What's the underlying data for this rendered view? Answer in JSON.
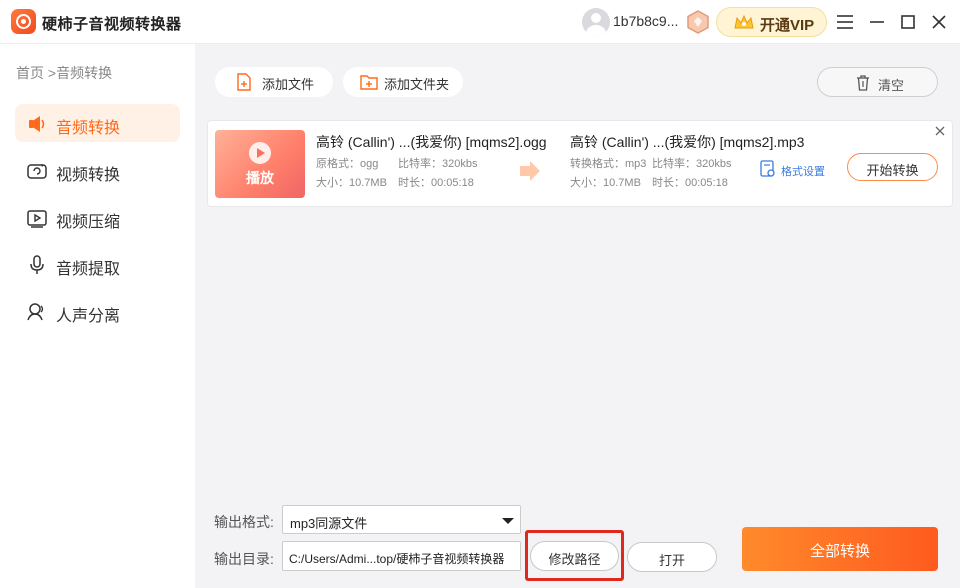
{
  "app": {
    "title": "硬柿子音视频转换器"
  },
  "header": {
    "username": "1b7b8c9...",
    "vip_label": "开通VIP"
  },
  "sidebar": {
    "breadcrumb": "首页 >音频转换",
    "items": [
      {
        "label": "音频转换",
        "icon": "audio-convert-icon",
        "active": true
      },
      {
        "label": "视频转换",
        "icon": "video-convert-icon",
        "active": false
      },
      {
        "label": "视频压缩",
        "icon": "video-compress-icon",
        "active": false
      },
      {
        "label": "音频提取",
        "icon": "audio-extract-icon",
        "active": false
      },
      {
        "label": "人声分离",
        "icon": "vocal-separate-icon",
        "active": false
      }
    ]
  },
  "toolbar": {
    "add_file": "添加文件",
    "add_folder": "添加文件夹",
    "clear": "清空"
  },
  "file": {
    "play_label": "播放",
    "source": {
      "name": "高铃 (Callin') ...(我爱你) [mqms2].ogg",
      "format": "原格式：ogg",
      "bitrate": "比特率：320kbs",
      "size": "大小：10.7MB",
      "duration": "时长：00:05:18"
    },
    "target": {
      "name": "高铃 (Callin') ...(我爱你) [mqms2].mp3",
      "format": "转换格式：mp3",
      "bitrate": "比特率：320kbs",
      "size": "大小：10.7MB",
      "duration": "时长：00:05:18"
    },
    "format_settings": "格式设置",
    "start_button": "开始转换"
  },
  "output": {
    "format_label": "输出格式:",
    "format_value": "mp3同源文件",
    "dir_label": "输出目录:",
    "dir_value": "C:/Users/Admi...top/硬柿子音视频转换器",
    "edit_path": "修改路径",
    "open": "打开",
    "convert_all": "全部转换"
  },
  "colors": {
    "accent": "#ff6a1a",
    "highlight_box": "#e0281e",
    "link": "#3a7be0"
  }
}
